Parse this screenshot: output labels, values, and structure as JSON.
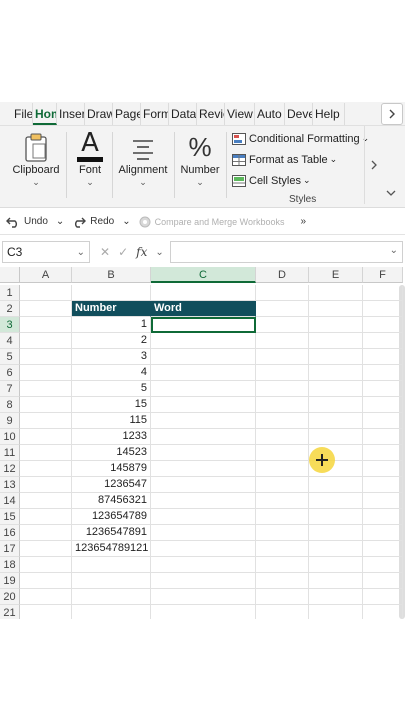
{
  "menu": {
    "tabs": [
      "File",
      "Hom",
      "Inser",
      "Draw",
      "Page",
      "Form",
      "Data",
      "Revie",
      "View",
      "Auto",
      "Deve",
      "Help"
    ],
    "active_index": 1
  },
  "ribbon": {
    "clipboard_label": "Clipboard",
    "font_label": "Font",
    "alignment_label": "Alignment",
    "number_label": "Number",
    "number_icon": "%",
    "font_icon": "A",
    "conditional_formatting": "Conditional Formatting",
    "format_as_table": "Format as Table",
    "cell_styles": "Cell Styles",
    "styles_group": "Styles"
  },
  "qat": {
    "undo": "Undo",
    "redo": "Redo",
    "compare_merge": "Compare and Merge Workbooks",
    "overflow": "»"
  },
  "formula_bar": {
    "name_box": "C3",
    "fx": "fx",
    "value": ""
  },
  "grid": {
    "columns": [
      "A",
      "B",
      "C",
      "D",
      "E",
      "F"
    ],
    "rows": [
      "1",
      "2",
      "3",
      "4",
      "5",
      "6",
      "7",
      "8",
      "9",
      "10",
      "11",
      "12",
      "13",
      "14",
      "15",
      "16",
      "17",
      "18",
      "19",
      "20",
      "21"
    ],
    "header_number": "Number",
    "header_word": "Word",
    "values": [
      "1",
      "2",
      "3",
      "4",
      "5",
      "15",
      "115",
      "1233",
      "14523",
      "145879",
      "1236547",
      "87456321",
      "123654789",
      "1236547891",
      "123654789121"
    ]
  },
  "colors": {
    "accent": "#0f6a37",
    "header_fill": "#114e5c",
    "cursor": "#f6d63c"
  }
}
